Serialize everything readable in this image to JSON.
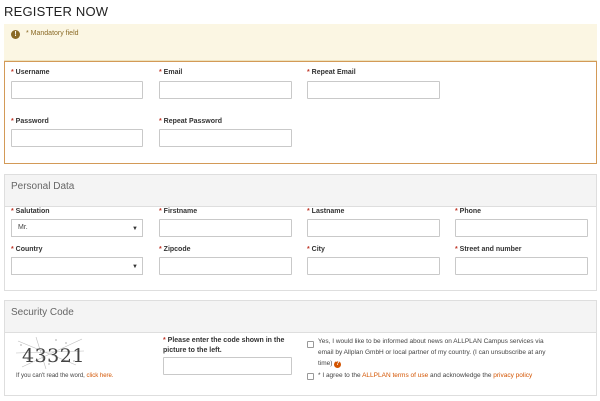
{
  "page": {
    "title": "REGISTER NOW"
  },
  "notice": {
    "icon": "exclamation-icon",
    "icon_glyph": "!",
    "text": "* Mandatory field"
  },
  "account": {
    "username_label": "Username",
    "email_label": "Email",
    "repeat_email_label": "Repeat Email",
    "password_label": "Password",
    "repeat_password_label": "Repeat Password"
  },
  "personal": {
    "heading": "Personal Data",
    "salutation_label": "Salutation",
    "salutation_value": "Mr.",
    "firstname_label": "Firstname",
    "lastname_label": "Lastname",
    "phone_label": "Phone",
    "country_label": "Country",
    "country_value": "",
    "zipcode_label": "Zipcode",
    "city_label": "City",
    "street_label": "Street and number"
  },
  "security": {
    "heading": "Security Code",
    "captcha_text": "43321",
    "cant_read_text": "If you can't read the word,",
    "click_here": "click here.",
    "code_label_1": "Please enter the code shown in the",
    "code_label_2": "picture to the left.",
    "newsletter_text_1": "Yes, I would like to be informed about news on ALLPLAN Campus services via",
    "newsletter_text_2": "email by Allplan GmbH or local partner of my country. (I can unsubscribe at any",
    "newsletter_text_3": "time)",
    "terms_prefix": "* I agree to the",
    "terms_link": "ALLPLAN terms of use",
    "terms_middle": "and acknowledge the",
    "privacy_link": "privacy policy"
  },
  "colors": {
    "accent": "#d35400",
    "notice_bg": "#fbf6e3",
    "notice_text": "#8a6a26",
    "required": "#c0392b"
  },
  "icons": {
    "select_caret": "chevron-down-icon",
    "help": "question-icon"
  }
}
